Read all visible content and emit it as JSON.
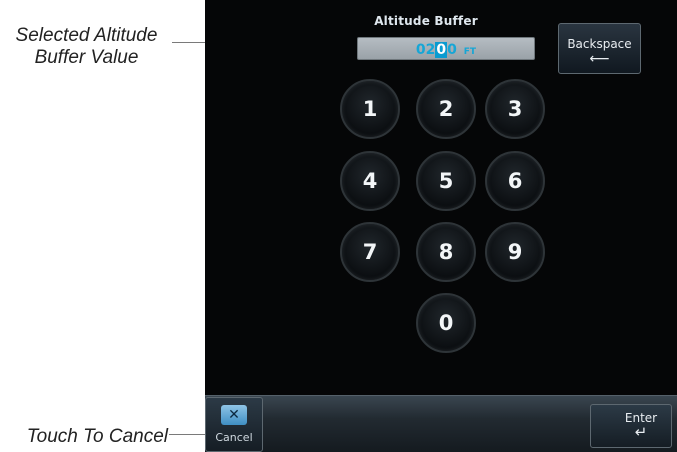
{
  "callouts": {
    "selected_value": "Selected Altitude\nBuffer Value",
    "cancel": "Touch To Cancel"
  },
  "header": {
    "title": "Altitude Buffer"
  },
  "field": {
    "value_prefix": "02",
    "value_cursor": "0",
    "value_suffix": "0",
    "unit": "FT"
  },
  "backspace": {
    "label": "Backspace",
    "arrow": "⟵"
  },
  "keypad": [
    "1",
    "2",
    "3",
    "4",
    "5",
    "6",
    "7",
    "8",
    "9",
    "0"
  ],
  "bottom": {
    "cancel_label": "Cancel",
    "cancel_icon": "✕",
    "enter_label": "Enter",
    "enter_arrow": "↵"
  }
}
